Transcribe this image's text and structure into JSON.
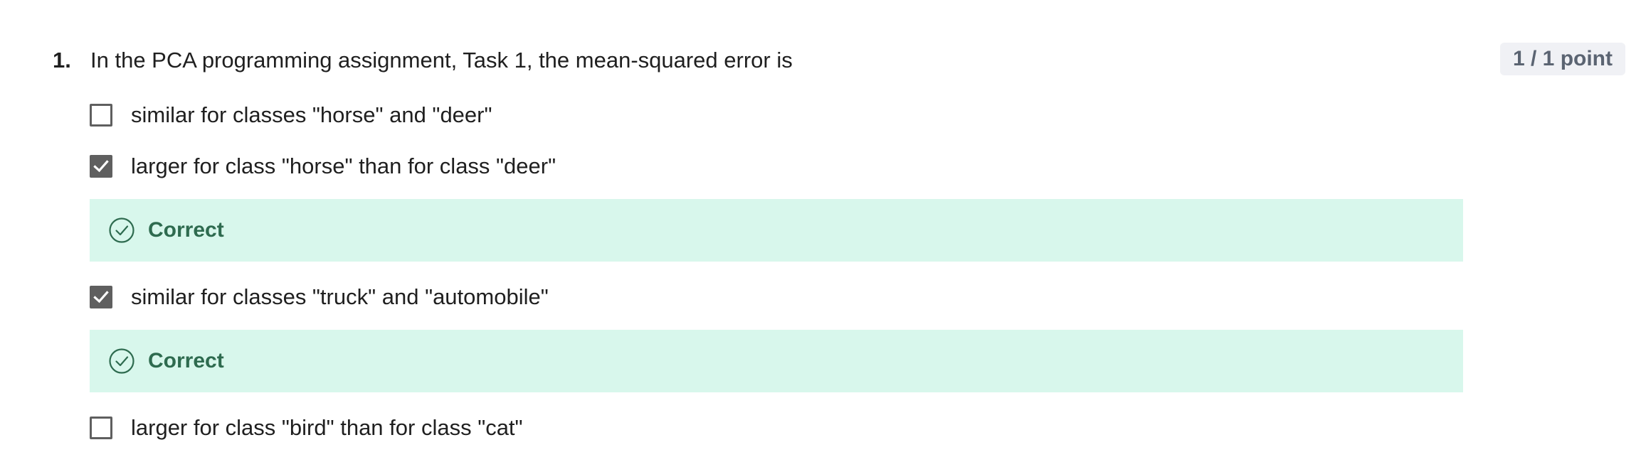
{
  "question": {
    "number": "1.",
    "text": "In the PCA programming assignment, Task 1, the mean-squared error is",
    "points": "1 / 1 point"
  },
  "options": [
    {
      "label": "similar for classes \"horse\" and \"deer\"",
      "checked": false
    },
    {
      "label": "larger for class \"horse\" than for class \"deer\"",
      "checked": true,
      "feedback": "Correct"
    },
    {
      "label": "similar for classes \"truck\" and \"automobile\"",
      "checked": true,
      "feedback": "Correct"
    },
    {
      "label": "larger for class \"bird\" than for class \"cat\"",
      "checked": false
    }
  ],
  "icons": {
    "checkbox_checked": "checkmark-icon",
    "feedback": "check-circle-icon"
  },
  "colors": {
    "checkbox": "#5f5f5f",
    "feedback_background": "#d8f7ec",
    "feedback_text": "#2e6b4f",
    "points_badge_background": "#f0f1f5",
    "points_badge_text": "#5b6472"
  }
}
